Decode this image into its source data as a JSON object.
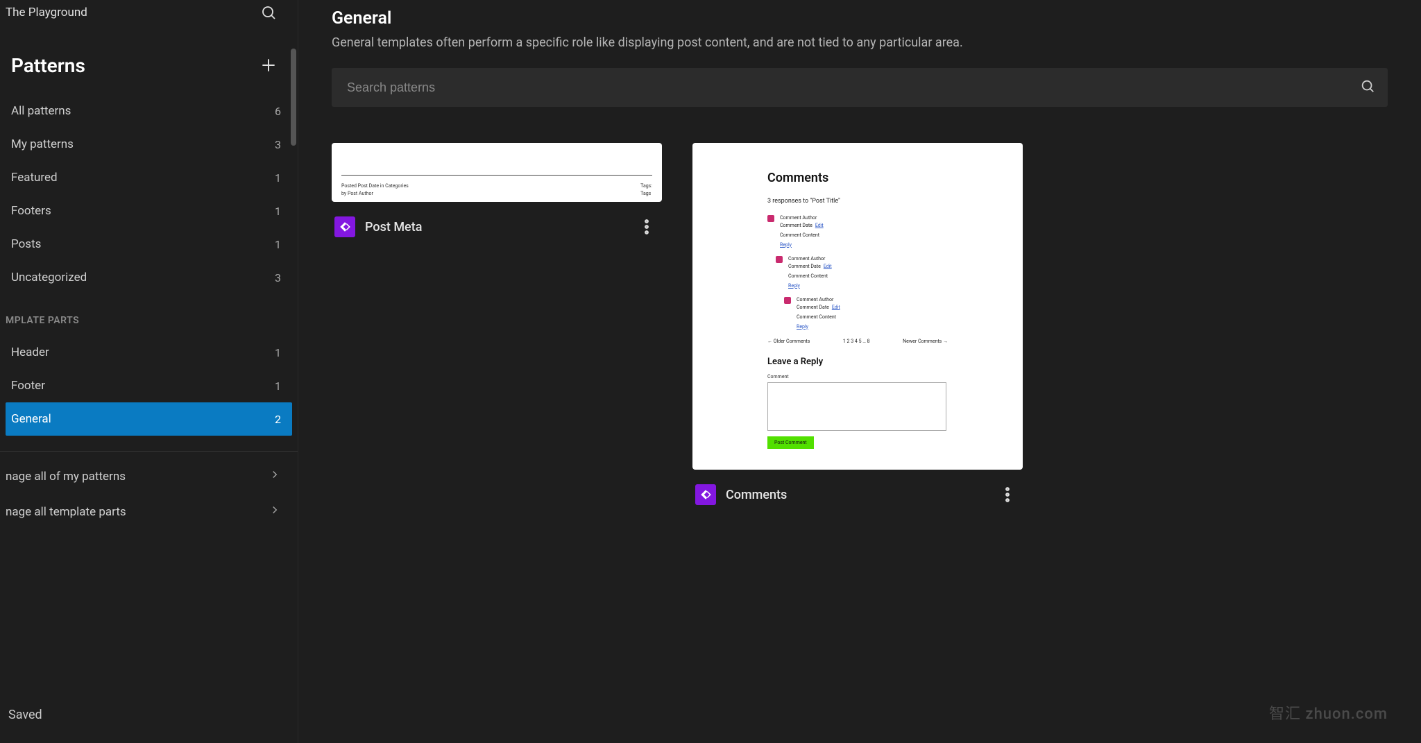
{
  "site": {
    "name": "The Playground"
  },
  "sidebar": {
    "title": "Patterns",
    "sub_heading": "MPLATE PARTS",
    "categories": [
      {
        "label": "All patterns",
        "count": "6"
      },
      {
        "label": "My patterns",
        "count": "3"
      },
      {
        "label": "Featured",
        "count": "1"
      },
      {
        "label": "Footers",
        "count": "1"
      },
      {
        "label": "Posts",
        "count": "1"
      },
      {
        "label": "Uncategorized",
        "count": "3"
      }
    ],
    "parts": [
      {
        "label": "Header",
        "count": "1"
      },
      {
        "label": "Footer",
        "count": "1"
      },
      {
        "label": "General",
        "count": "2",
        "active": true
      }
    ],
    "manage": {
      "patterns": "nage all of my patterns",
      "parts": "nage all template parts"
    },
    "saved": "Saved"
  },
  "main": {
    "title": "General",
    "desc": "General templates often perform a specific role like displaying post content, and are not tied to any particular area.",
    "search_placeholder": "Search patterns"
  },
  "cards": {
    "post_meta": {
      "label": "Post Meta",
      "line1a": "Posted   Post Date   in   Categories",
      "line1b": "Tags:",
      "line2a": "by   Post Author",
      "line2b": "Tags"
    },
    "comments": {
      "label": "Comments",
      "title": "Comments",
      "sub": "3 responses to \"Post Title\"",
      "author": "Comment Author",
      "date": "Comment Date",
      "edit": "Edit",
      "content": "Comment Content",
      "reply": "Reply",
      "older": "←   Older Comments",
      "pages": "1 2 3 4 5 … 8",
      "newer": "Newer Comments   →",
      "leave": "Leave a Reply",
      "field": "Comment",
      "post": "Post Comment"
    }
  },
  "watermark": "智汇 zhuon.com"
}
